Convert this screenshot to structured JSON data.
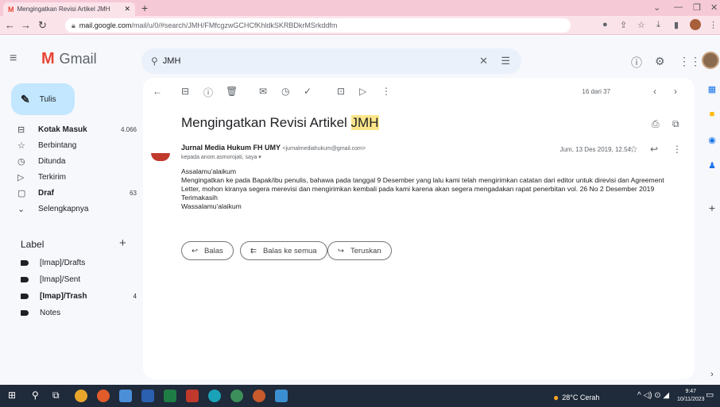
{
  "browser": {
    "tab_title": "Mengingatkan Revisi Artikel JMH",
    "url_domain": "mail.google.com",
    "url_path": "/mail/u/0/#search/JMH/FMfcgzwGCHCfKhldkSKRBDkrMSrkddfm"
  },
  "gmail": {
    "brand": "Gmail",
    "search_value": "JMH",
    "compose": "Tulis",
    "nav": [
      {
        "label": "Kotak Masuk",
        "count": "4.066",
        "icon": "inbox-icon",
        "bold": true
      },
      {
        "label": "Berbintang",
        "count": "",
        "icon": "star-icon",
        "bold": false
      },
      {
        "label": "Ditunda",
        "count": "",
        "icon": "clock-icon",
        "bold": false
      },
      {
        "label": "Terkirim",
        "count": "",
        "icon": "send-icon",
        "bold": false
      },
      {
        "label": "Draf",
        "count": "63",
        "icon": "draft-icon",
        "bold": true
      },
      {
        "label": "Selengkapnya",
        "count": "",
        "icon": "chevron-down-icon",
        "bold": false
      }
    ],
    "labels_header": "Label",
    "labels": [
      {
        "label": "[Imap]/Drafts",
        "count": "",
        "bold": false
      },
      {
        "label": "[Imap]/Sent",
        "count": "",
        "bold": false
      },
      {
        "label": "[Imap]/Trash",
        "count": "4",
        "bold": true
      },
      {
        "label": "Notes",
        "count": "",
        "bold": false
      }
    ]
  },
  "message": {
    "pager": "16 dari 37",
    "subject": "Mengingatkan Revisi Artikel ",
    "subject_highlight": "JMH",
    "sender_name": "Jurnal Media Hukum FH UMY",
    "sender_email": "<jurnalmediahukum@gmail.com>",
    "recipients": "kepada anom.asmorojati, saya",
    "date": "Jum, 13 Des 2019, 12.54",
    "body": [
      "Assalamu'alaikum",
      "Mengingatkan ke pada Bapak/ibu penulis, bahawa pada tanggal 9 Desember yang lalu kami telah mengirimkan catatan dari editor untuk direvisi dan Agreement Letter, mohon kiranya segera merevisi dan mengirimkan kembali pada kami karena akan segera mengadakan rapat penerbitan vol. 26 No 2 Desember 2019",
      "Terimakasih",
      "Wassalamu'alaikum"
    ],
    "reply": "Balas",
    "reply_all": "Balas ke semua",
    "forward": "Teruskan"
  },
  "taskbar": {
    "weather": "28°C  Cerah",
    "time": "9:47",
    "date": "10/11/2023"
  },
  "colors": {
    "tabbar": "#f6c9d6",
    "app_bg": "#f6f8fc",
    "compose_bg": "#c2e7ff",
    "highlight": "#fce68a",
    "taskbar": "#1f2a3a"
  }
}
